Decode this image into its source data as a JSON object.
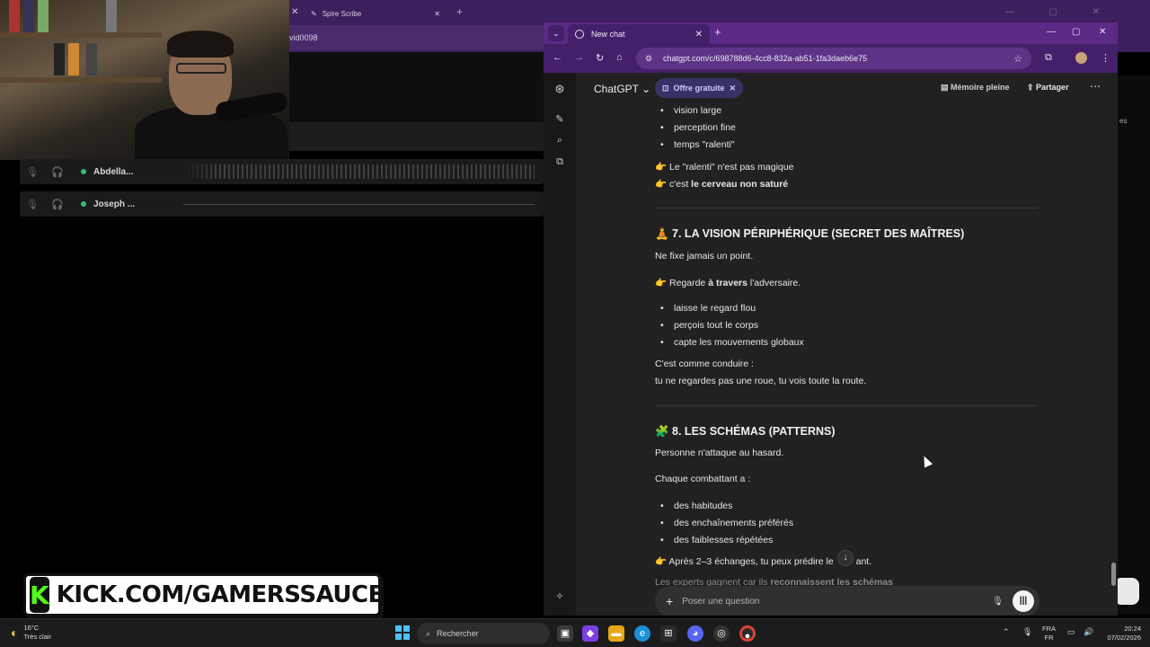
{
  "background": {
    "tab_title": "Spire Scribe",
    "url_fragment": "vid0098",
    "right_stub_label": "es",
    "voice_participants": [
      {
        "name": "Abdella..."
      },
      {
        "name": "Joseph ..."
      }
    ],
    "kick_banner": "KICK.COM/GAMERSSAUCE"
  },
  "browser": {
    "tab_title": "New chat",
    "url": "chatgpt.com/c/698788d6-4cc8-832a-ab51-1fa3daeb6e75",
    "accent_color": "#5a2a86"
  },
  "chatgpt": {
    "model_label": "ChatGPT",
    "offer_label": "Offre gratuite",
    "memory_label": "Mémoire pleine",
    "share_label": "Partager",
    "top_bullets": [
      "vision large",
      "perception fine",
      "temps \"ralenti\""
    ],
    "top_line1": "👉 Le \"ralenti\" n'est pas magique",
    "top_line2_pre": "👉 c'est ",
    "top_line2_bold": "le cerveau non saturé",
    "section7": {
      "title": "🧘 7. LA VISION PÉRIPHÉRIQUE (SECRET DES MAÎTRES)",
      "p1": "Ne fixe jamais un point.",
      "p2_pre": "👉 Regarde ",
      "p2_bold": "à travers",
      "p2_post": " l'adversaire.",
      "bullets": [
        "laisse le regard flou",
        "perçois tout le corps",
        "capte les mouvements globaux"
      ],
      "p3": "C'est comme conduire :",
      "p4": "tu ne regardes pas une roue, tu vois toute la route."
    },
    "section8": {
      "title": "🧩 8. LES SCHÉMAS (PATTERNS)",
      "p1": "Personne n'attaque au hasard.",
      "p2": "Chaque combattant a :",
      "bullets": [
        "des habitudes",
        "des enchaînements préférés",
        "des faiblesses répétées"
      ],
      "p3_pre": "👉 Après 2–3 échanges, tu peux prédire le ",
      "p3_post": "ant.",
      "p4_pre": "Les experts gagnent car ils ",
      "p4_bold": "reconnaissent les schémas"
    },
    "composer_placeholder": "Poser une question"
  },
  "taskbar": {
    "temperature": "16°C",
    "weather": "Très clair",
    "search_label": "Rechercher",
    "lang_top": "FRA",
    "lang_bottom": "FR",
    "time": "20:24",
    "date": "07/02/2026"
  }
}
